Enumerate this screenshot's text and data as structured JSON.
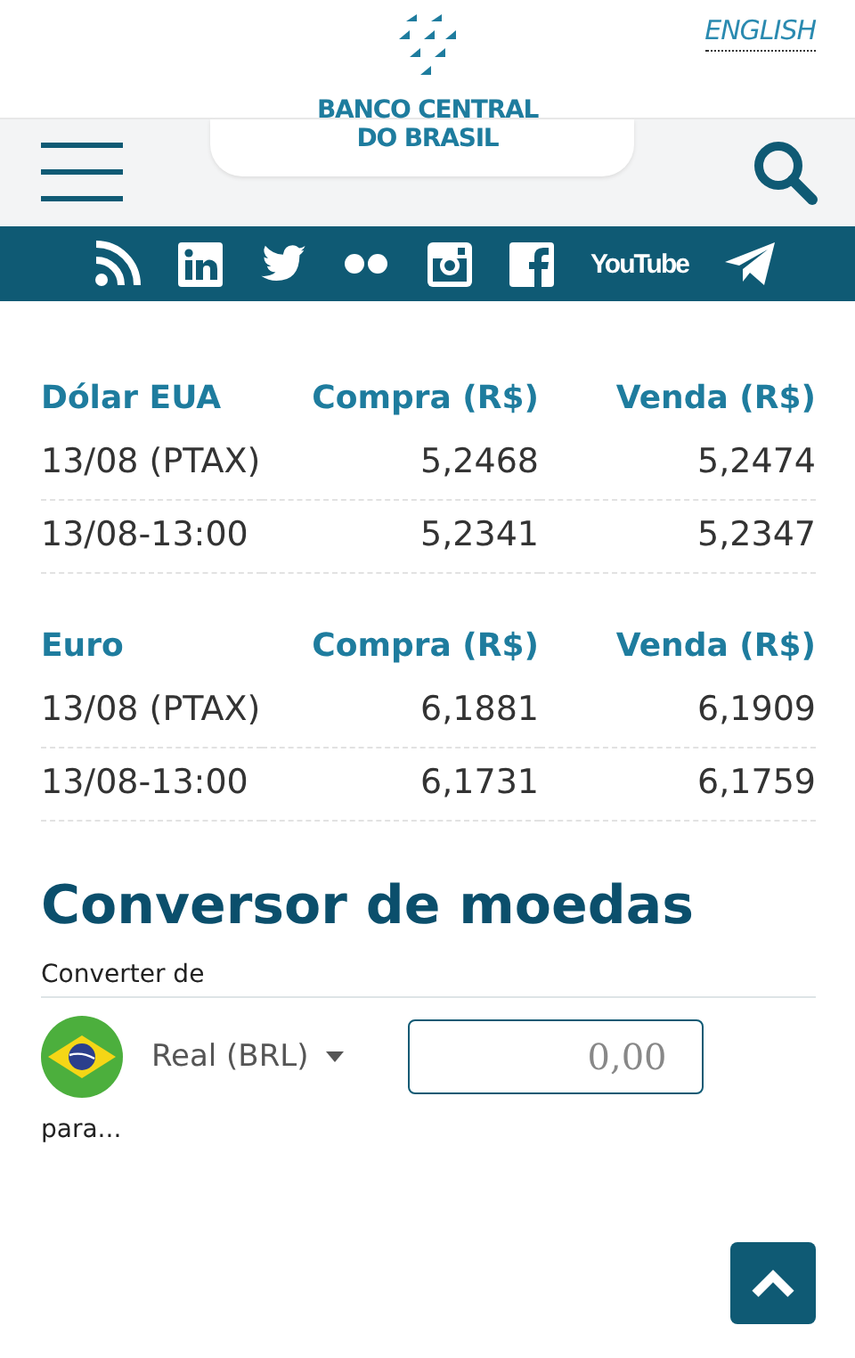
{
  "header": {
    "language_link": "ENGLISH",
    "logo_lines": [
      "BANCO CENTRAL",
      "DO BRASIL"
    ]
  },
  "social": [
    {
      "kind": "rss"
    },
    {
      "kind": "linkedin"
    },
    {
      "kind": "twitter"
    },
    {
      "kind": "flickr"
    },
    {
      "kind": "instagram"
    },
    {
      "kind": "facebook"
    },
    {
      "kind": "youtube",
      "label": "YouTube"
    },
    {
      "kind": "telegram"
    }
  ],
  "quotes": {
    "tables": [
      {
        "columns": [
          "Dólar EUA",
          "Compra (R$)",
          "Venda (R$)"
        ],
        "rows": [
          [
            "13/08 (PTAX)",
            "5,2468",
            "5,2474"
          ],
          [
            "13/08-13:00",
            "5,2341",
            "5,2347"
          ]
        ]
      },
      {
        "columns": [
          "Euro",
          "Compra (R$)",
          "Venda (R$)"
        ],
        "rows": [
          [
            "13/08 (PTAX)",
            "6,1881",
            "6,1909"
          ],
          [
            "13/08-13:00",
            "6,1731",
            "6,1759"
          ]
        ]
      }
    ]
  },
  "converter": {
    "title": "Conversor de moedas",
    "from_label": "Converter de",
    "currency": "Real (BRL)",
    "amount_placeholder": "0,00",
    "to_label": "para..."
  }
}
